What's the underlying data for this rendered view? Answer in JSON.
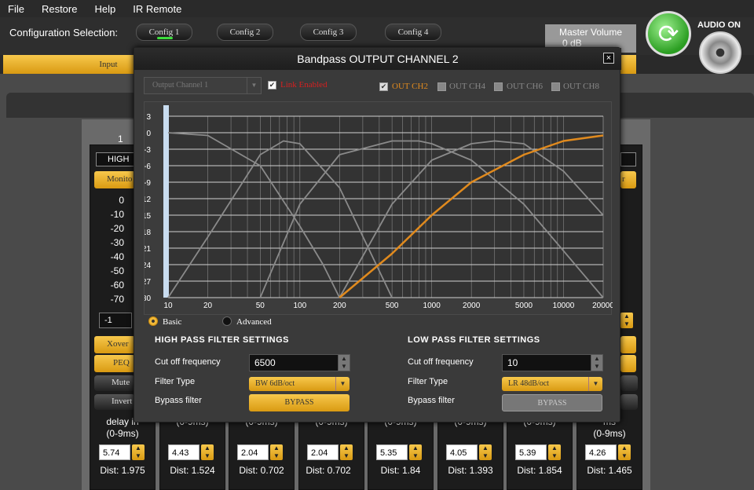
{
  "menu": [
    "File",
    "Restore",
    "Help",
    "IR Remote"
  ],
  "config": {
    "label": "Configuration Selection:",
    "buttons": [
      "Config 1",
      "Config 2",
      "Config 3",
      "Config 4"
    ]
  },
  "master_volume": {
    "label": "Master Volume",
    "value": "0 dB"
  },
  "audio_label": "AUDIO ON",
  "tabs": {
    "input": "Input"
  },
  "background": {
    "channel_num": "1",
    "selector_value": "HIGH",
    "monitor_label": "Monito",
    "right_monitor_label": "r",
    "vu_scale": [
      "0",
      "-10",
      "-20",
      "-30",
      "-40",
      "-50",
      "-60",
      "-70"
    ],
    "level_value": "-1",
    "xover_label": "Xover",
    "peq_label": "PEQ",
    "mute_label": "Mute",
    "invert_label": "Invert",
    "delay_labels": [
      {
        "title": "delay in",
        "range": "(0-9ms)"
      },
      {
        "title": "",
        "range": "(0-9ms)"
      },
      {
        "title": "",
        "range": "(0-9ms)"
      },
      {
        "title": "",
        "range": "(0-9ms)"
      },
      {
        "title": "",
        "range": "(0-9ms)"
      },
      {
        "title": "",
        "range": "(0-9ms)"
      },
      {
        "title": "",
        "range": "(0-9ms)"
      },
      {
        "title": "ms",
        "range": "(0-9ms)"
      }
    ],
    "delays": [
      "5.74",
      "4.43",
      "2.04",
      "2.04",
      "5.35",
      "4.05",
      "5.39",
      "4.26"
    ],
    "dists": [
      "Dist: 1.975",
      "Dist: 1.524",
      "Dist: 0.702",
      "Dist: 0.702",
      "Dist: 1.84",
      "Dist: 1.393",
      "Dist: 1.854",
      "Dist: 1.465"
    ]
  },
  "dialog": {
    "title": "Bandpass OUTPUT CHANNEL 2",
    "close": "×",
    "output_select": "Output Channel 1",
    "link_label": "Link Enabled",
    "outputs": [
      {
        "label": "OUT CH2",
        "checked": true
      },
      {
        "label": "OUT CH4",
        "checked": false
      },
      {
        "label": "OUT CH6",
        "checked": false
      },
      {
        "label": "OUT CH8",
        "checked": false
      }
    ],
    "mode_basic": "Basic",
    "mode_advanced": "Advanced",
    "hp": {
      "header": "HIGH PASS FILTER SETTINGS",
      "cutoff_label": "Cut off frequency",
      "cutoff_value": "6500",
      "type_label": "Filter Type",
      "type_value": "BW 6dB/oct",
      "bypass_label": "Bypass filter",
      "bypass_button": "BYPASS"
    },
    "lp": {
      "header": "LOW PASS FILTER SETTINGS",
      "cutoff_label": "Cut off frequency",
      "cutoff_value": "10",
      "type_label": "Filter Type",
      "type_value": "LR 48dB/oct",
      "bypass_label": "Bypass filter",
      "bypass_button": "BYPASS"
    }
  },
  "chart_data": {
    "type": "line",
    "x_ticks": [
      "10",
      "20",
      "50",
      "100",
      "200",
      "500",
      "1000",
      "2000",
      "5000",
      "10000",
      "20000"
    ],
    "y_ticks": [
      "3",
      "0",
      "-3",
      "-6",
      "-9",
      "-12",
      "-15",
      "-18",
      "-21",
      "-24",
      "-27",
      "-30"
    ],
    "xlim": [
      10,
      20000
    ],
    "ylim": [
      -30,
      3
    ],
    "xscale": "log",
    "grid": true,
    "active_color": "#e08a1e",
    "inactive_color": "#8a8a8a",
    "series": [
      {
        "active": false,
        "x": [
          10,
          20,
          50,
          100,
          150,
          200,
          300
        ],
        "y": [
          0,
          -0.5,
          -6,
          -17,
          -24,
          -30,
          -30
        ]
      },
      {
        "active": false,
        "x": [
          10,
          20,
          50,
          75,
          100,
          200,
          500
        ],
        "y": [
          -30,
          -19,
          -4,
          -1.5,
          -2,
          -10,
          -30
        ]
      },
      {
        "active": false,
        "x": [
          50,
          100,
          200,
          500,
          800,
          1000,
          2000,
          5000,
          20000
        ],
        "y": [
          -30,
          -13,
          -4,
          -1.5,
          -1.5,
          -2,
          -5,
          -13,
          -30
        ]
      },
      {
        "active": false,
        "x": [
          200,
          500,
          1000,
          2000,
          3000,
          5000,
          10000,
          20000
        ],
        "y": [
          -30,
          -13,
          -5,
          -2,
          -1.5,
          -2,
          -7,
          -15
        ]
      },
      {
        "active": true,
        "x": [
          200,
          500,
          1000,
          2000,
          5000,
          10000,
          20000
        ],
        "y": [
          -30,
          -22,
          -15,
          -9,
          -4,
          -1.5,
          -0.5
        ]
      }
    ]
  }
}
